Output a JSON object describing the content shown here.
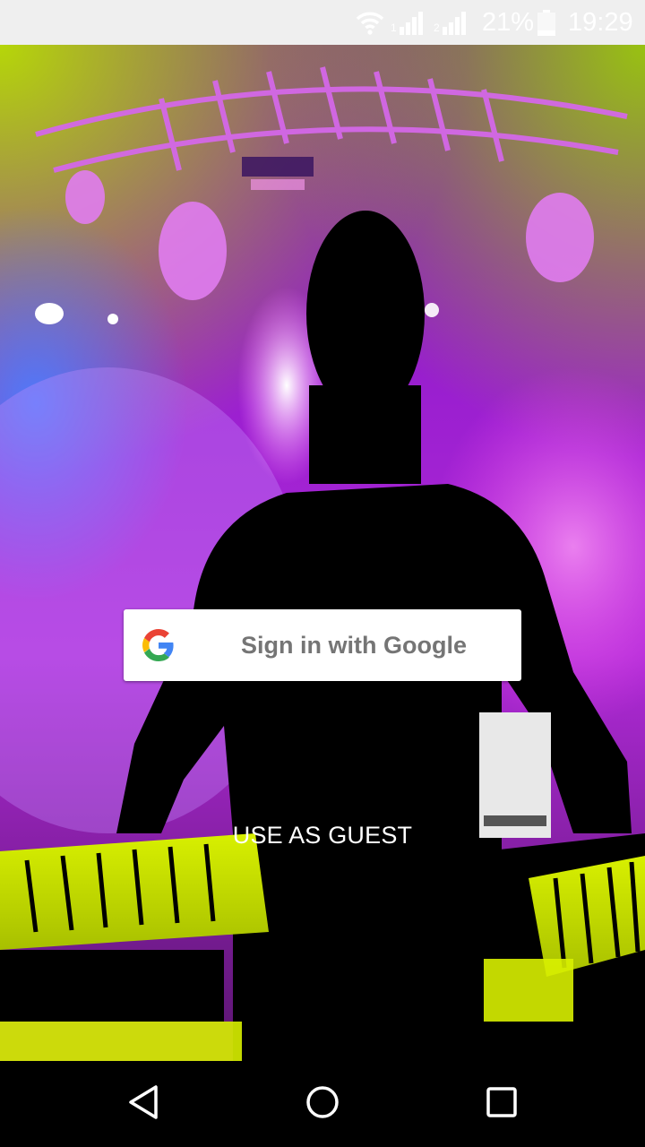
{
  "status_bar": {
    "sim1_label": "1",
    "sim2_label": "2",
    "battery_percent": "21%",
    "time": "19:29",
    "icons": [
      "wifi-icon",
      "signal-icon",
      "signal-icon",
      "battery-icon"
    ]
  },
  "background": {
    "description_icon": "dj-concert-image"
  },
  "login": {
    "google_label": "Sign in with Google",
    "guest_label": "USE AS GUEST"
  },
  "nav_bar": {
    "icons": [
      "back-icon",
      "home-icon",
      "recents-icon"
    ]
  },
  "colors": {
    "status_bar_bg": "#efefef",
    "google_text": "#757575",
    "google_blue": "#4285F4",
    "google_red": "#EA4335",
    "google_yellow": "#FBBC05",
    "google_green": "#34A853",
    "nav_bg": "#000000"
  }
}
